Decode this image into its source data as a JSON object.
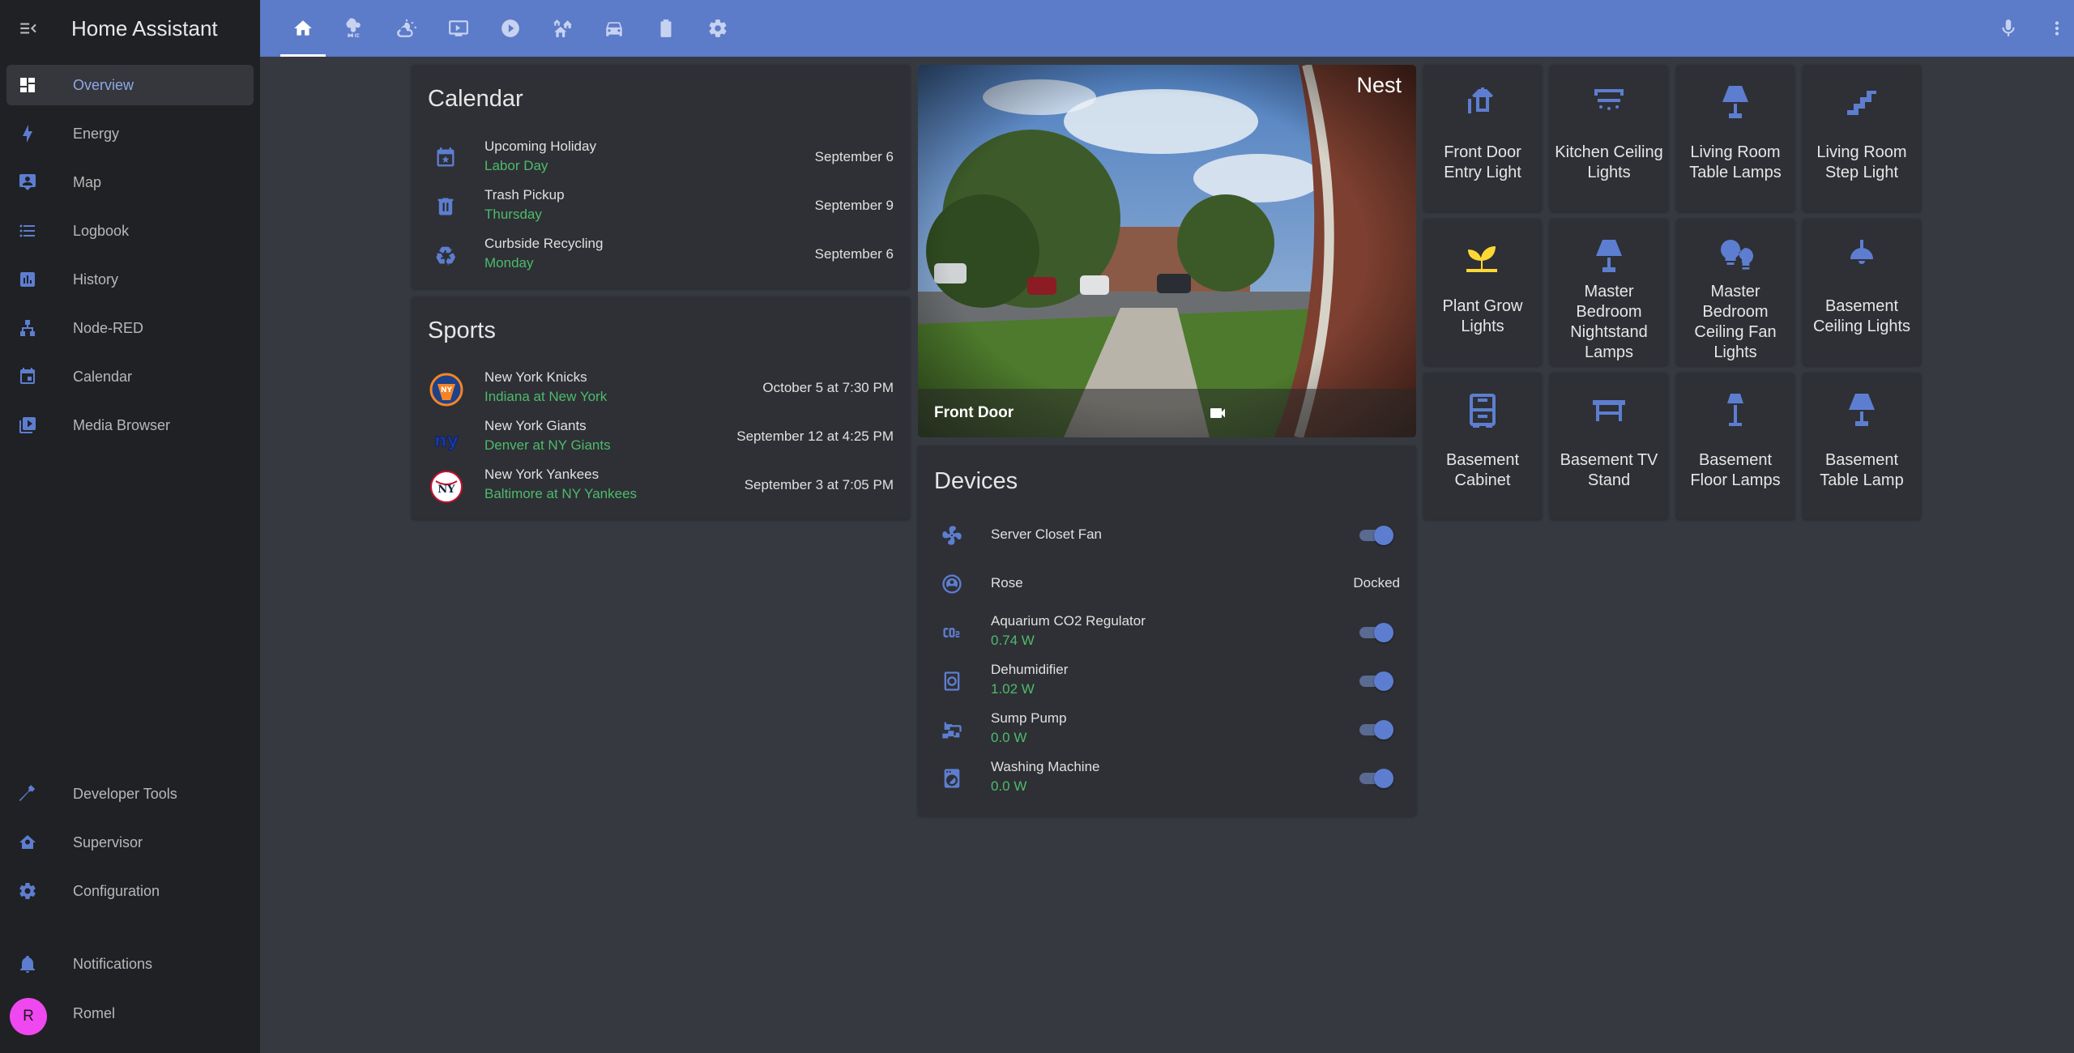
{
  "app": {
    "title": "Home Assistant"
  },
  "sidebar": {
    "items": [
      {
        "label": "Overview",
        "icon": "overview-icon",
        "active": true
      },
      {
        "label": "Energy",
        "icon": "energy-icon"
      },
      {
        "label": "Map",
        "icon": "map-icon"
      },
      {
        "label": "Logbook",
        "icon": "logbook-icon"
      },
      {
        "label": "History",
        "icon": "history-icon"
      },
      {
        "label": "Node-RED",
        "icon": "node-red-icon"
      },
      {
        "label": "Calendar",
        "icon": "calendar-icon"
      },
      {
        "label": "Media Browser",
        "icon": "media-browser-icon"
      }
    ],
    "bottom": [
      {
        "label": "Developer Tools",
        "icon": "hammer-icon"
      },
      {
        "label": "Supervisor",
        "icon": "supervisor-icon"
      },
      {
        "label": "Configuration",
        "icon": "gear-icon"
      }
    ],
    "notifications": "Notifications",
    "user": {
      "initial": "R",
      "name": "Romel"
    }
  },
  "topbar": {
    "tabs": [
      "home-icon",
      "air-conditioner-icon",
      "weather-icon",
      "monitor-icon",
      "play-icon",
      "home-group-icon",
      "car-icon",
      "battery-icon",
      "gear-icon"
    ],
    "actions": [
      "microphone-icon",
      "more-vertical-icon"
    ]
  },
  "calendar": {
    "title": "Calendar",
    "events": [
      {
        "name": "Upcoming Holiday",
        "detail": "Labor Day",
        "date": "September 6",
        "icon": "calendar-star-icon"
      },
      {
        "name": "Trash Pickup",
        "detail": "Thursday",
        "date": "September 9",
        "icon": "trash-can-icon"
      },
      {
        "name": "Curbside Recycling",
        "detail": "Monday",
        "date": "September 6",
        "icon": "recycle-icon"
      }
    ]
  },
  "sports": {
    "title": "Sports",
    "games": [
      {
        "team": "New York Knicks",
        "match": "Indiana at New York",
        "date": "October 5 at 7:30 PM",
        "logo": "knicks-logo"
      },
      {
        "team": "New York Giants",
        "match": "Denver at NY Giants",
        "date": "September 12 at 4:25 PM",
        "logo": "giants-logo"
      },
      {
        "team": "New York Yankees",
        "match": "Baltimore at NY Yankees",
        "date": "September 3 at 7:05 PM",
        "logo": "yankees-logo"
      }
    ]
  },
  "camera": {
    "name": "Front Door",
    "brand": "Nest"
  },
  "devices": {
    "title": "Devices",
    "items": [
      {
        "name": "Server Closet Fan",
        "detail": "",
        "state": "on",
        "icon": "fan-icon"
      },
      {
        "name": "Rose",
        "detail": "",
        "status": "Docked",
        "icon": "robot-vacuum-icon"
      },
      {
        "name": "Aquarium CO2 Regulator",
        "detail": "0.74 W",
        "state": "on",
        "icon": "co2-icon"
      },
      {
        "name": "Dehumidifier",
        "detail": "1.02 W",
        "state": "on",
        "icon": "dehumidifier-icon"
      },
      {
        "name": "Sump Pump",
        "detail": "0.0 W",
        "state": "on",
        "icon": "pipe-icon"
      },
      {
        "name": "Washing Machine",
        "detail": "0.0 W",
        "state": "on",
        "icon": "washing-machine-icon"
      }
    ]
  },
  "tiles": [
    {
      "label": "Front Door Entry Light",
      "icon": "outdoor-lamp-icon"
    },
    {
      "label": "Kitchen Ceiling Lights",
      "icon": "ceiling-light-icon"
    },
    {
      "label": "Living Room Table Lamps",
      "icon": "table-lamp-icon"
    },
    {
      "label": "Living Room Step Light",
      "icon": "stairs-icon"
    },
    {
      "label": "Plant Grow Lights",
      "icon": "sprout-icon",
      "on": true
    },
    {
      "label": "Master Bedroom Nightstand Lamps",
      "icon": "lamp-icon"
    },
    {
      "label": "Master Bedroom Ceiling Fan Lights",
      "icon": "bulbs-icon"
    },
    {
      "label": "Basement Ceiling Lights",
      "icon": "ceiling-lamp-icon"
    },
    {
      "label": "Basement Cabinet",
      "icon": "cabinet-icon"
    },
    {
      "label": "Basement TV Stand",
      "icon": "desk-icon"
    },
    {
      "label": "Basement Floor Lamps",
      "icon": "floor-lamp-icon"
    },
    {
      "label": "Basement Table Lamp",
      "icon": "table-lamp-icon"
    }
  ],
  "colors": {
    "accent": "#5c7bc9",
    "icon": "#5d7ed0",
    "secondary_text": "#4dbb6b",
    "tile_on": "#fdd835",
    "avatar": "#ef48f0"
  }
}
